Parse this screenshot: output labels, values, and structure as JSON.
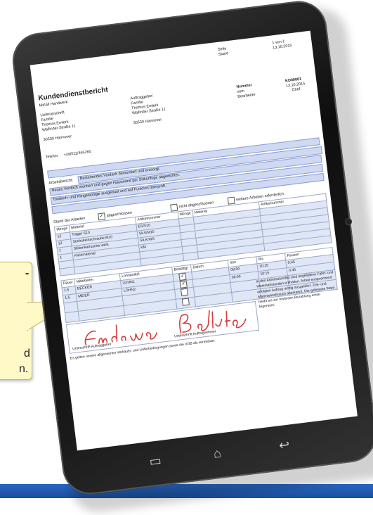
{
  "callout": {
    "line1": "-",
    "line2": "d",
    "line3": "n."
  },
  "document": {
    "title": "Kundendienstbericht",
    "subtitle": "Metall Handwerk",
    "page_label": "Seite",
    "page_value": "1 von 1",
    "date_label": "Stand",
    "date_value": "13.10.2015",
    "delivery_label": "Lieferanschrift",
    "delivery_lines": [
      "Familie",
      "Thomas Emlerk",
      "Wallinder Straße 11",
      "",
      "30530 Hannover"
    ],
    "phone_label": "Telefon",
    "phone_value": "+49/511/465260",
    "client_label": "Auftraggeber:",
    "client_lines": [
      "Familie",
      "Thomas Emlerk",
      "Wallinder Straße 11",
      "",
      "30530 Hannover"
    ],
    "meta_labels": [
      "Nummer",
      "vom",
      "Bearbeiter"
    ],
    "meta_values": [
      "KD00001",
      "13.10.2015",
      "Chef"
    ],
    "work_label": "Arbeitsbericht:",
    "work_lines": [
      "Bestehendes Vordach demontiert und entsorgt.",
      "Neues Vordach montiert und gegen Hauswand per Silikonfuge abgedichtet.",
      "Tondach- und Klingelanlage ausgebaut und auf Funktion überprüft."
    ],
    "status_label": "Stand der Arbeiten",
    "status_options": [
      "abgeschlossen",
      "nicht abgeschlossen",
      "weitere Arbeiten erforderlich"
    ],
    "material_headers": [
      "Menge",
      "Material",
      "Artikelnummer",
      "Menge",
      "Material",
      "Artikelnummer"
    ],
    "material_rows": [
      {
        "qty": "12",
        "name": "Träger S10",
        "art": "ES/S10"
      },
      {
        "qty": "12",
        "name": "Sechskantschraube M10",
        "art": "SKS/M10"
      },
      {
        "qty": "1",
        "name": "Silikonkartusche weiß",
        "art": "SILK/WS"
      },
      {
        "qty": "1",
        "name": "Kleinmaterial",
        "art": "KM"
      }
    ],
    "time_headers": [
      "Dauer",
      "Mitarbeiter",
      "Lohnartikel",
      "Bestätigt",
      "Datum",
      "Von",
      "Bis",
      "Pausen"
    ],
    "time_rows": [
      {
        "dur": "1,5",
        "emp": "BECKER",
        "wage": "LOHN1",
        "from": "08:00",
        "to": "10:15",
        "pause": "0:45"
      },
      {
        "dur": "1,5",
        "emp": "MEIER",
        "wage": "LOHN2",
        "from": "08:00",
        "to": "10:15",
        "pause": "0:45"
      }
    ],
    "note_text": "In den Arbeitsstunden sind angefallene Fahrt- und Werkstattstunden enthalten. Arbeit entsprechend erfolgten Auftrag richtig ausgeführt. Zeit- und Materialverbrauch anerkannt. Die geleistete Ware bleibt bis zur restlosen Bezahlung unser Eigentum.",
    "sign_left_label": "Unterschrift Auftraggeber",
    "sign_right_label": "Unterschrift Auftragnehmer",
    "footer_text": "Es gelten unsere allgemeinen Verkaufs- und Lieferbedingungen sowie die VOB als vereinbart."
  },
  "nav": {
    "recent_icon": "recent-apps-icon",
    "home_icon": "home-icon",
    "back_icon": "back-icon"
  },
  "colors": {
    "bezel": "#1a1a1a",
    "form_blue": "#cfd9f2",
    "signature_red": "#d43b3b",
    "bottom_bar": "#1f57ab",
    "callout_bg": "#fff9c8"
  }
}
